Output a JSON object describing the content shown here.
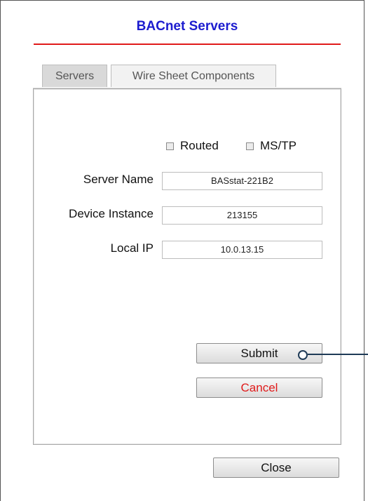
{
  "window": {
    "title": "BACnet Servers"
  },
  "tabs": [
    {
      "label": "Servers"
    },
    {
      "label": "Wire Sheet Components"
    }
  ],
  "options": {
    "routed_label": "Routed",
    "mstp_label": "MS/TP"
  },
  "form": {
    "server_name": {
      "label": "Server Name",
      "value": "BASstat-221B2"
    },
    "device_instance": {
      "label": "Device Instance",
      "value": "213155"
    },
    "local_ip": {
      "label": "Local IP",
      "value": "10.0.13.15"
    }
  },
  "buttons": {
    "submit": "Submit",
    "cancel": "Cancel",
    "close": "Close"
  },
  "colors": {
    "title": "#1c1ccf",
    "accent_rule": "#e01a1a",
    "cancel_text": "#e01a1a",
    "callout": "#1f3b57"
  }
}
